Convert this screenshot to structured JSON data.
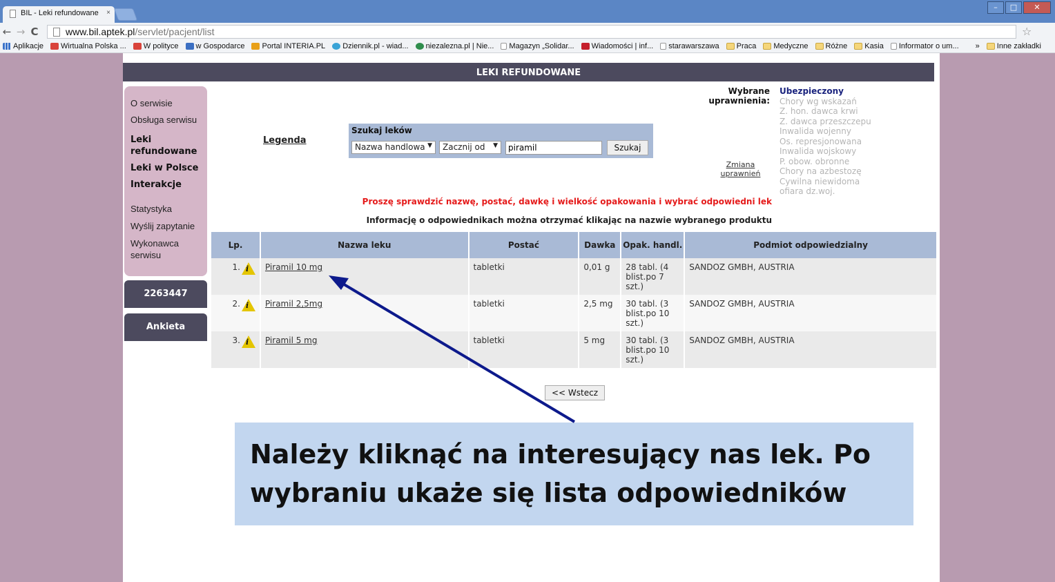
{
  "browser": {
    "tab_title": "BIL - Leki refundowane",
    "tab_close": "×",
    "url_domain": "www.bil.aptek.pl",
    "url_path": "/servlet/pacjent/list",
    "bookmarks": [
      "Aplikacje",
      "Wirtualna Polska ...",
      "W polityce",
      "w Gospodarce",
      "Portal INTERIA.PL",
      "Dziennik.pl - wiad...",
      "niezalezna.pl | Nie...",
      "Magazyn „Solidar...",
      "Wiadomości | inf...",
      "starawarszawa",
      "Praca",
      "Medyczne",
      "Różne",
      "Kasia",
      "Informator o um..."
    ],
    "bookmarks_more": "»",
    "other_bookmarks": "Inne zakładki"
  },
  "header": {
    "title": "LEKI REFUNDOWANE"
  },
  "sidebar": {
    "items": [
      "O serwisie",
      "Obsługa serwisu"
    ],
    "bold_items": [
      "Leki refundowane",
      "Leki w Polsce",
      "Interakcje"
    ],
    "items2": [
      "Statystyka",
      "Wyślij zapytanie",
      "Wykonawca serwisu"
    ],
    "counter": "2263447",
    "survey": "Ankieta"
  },
  "legend_link": "Legenda",
  "search": {
    "title": "Szukaj leków",
    "field_select": "Nazwa handlowa",
    "mode_select": "Zacznij od",
    "query": "piramil",
    "button": "Szukaj"
  },
  "permissions": {
    "label": "Wybrane uprawnienia:",
    "change_link": "Zmiana uprawnień",
    "items": [
      "Ubezpieczony",
      "Chory wg wskazań",
      "Z. hon. dawca krwi",
      "Z. dawca przeszczepu",
      "Inwalida wojenny",
      "Os. represjonowana",
      "Inwalida wojskowy",
      "P. obow. obronne",
      "Chory na azbestozę",
      "Cywilna niewidoma ofiara dz.woj."
    ]
  },
  "messages": {
    "warning": "Proszę sprawdzić nazwę, postać, dawkę i wielkość opakowania i wybrać odpowiedni lek",
    "info": "Informację o odpowiednikach można otrzymać klikając na nazwie wybranego produktu"
  },
  "table": {
    "headers": [
      "Lp.",
      "Nazwa leku",
      "Postać",
      "Dawka",
      "Opak. handl.",
      "Podmiot odpowiedzialny"
    ],
    "rows": [
      {
        "lp": "1.",
        "name": "Piramil 10 mg",
        "form": "tabletki",
        "dose": "0,01 g",
        "pack": "28 tabl. (4 blist.po 7 szt.)",
        "company": "SANDOZ GMBH, AUSTRIA"
      },
      {
        "lp": "2.",
        "name": "Piramil 2,5mg",
        "form": "tabletki",
        "dose": "2,5 mg",
        "pack": "30 tabl. (3 blist.po 10 szt.)",
        "company": "SANDOZ GMBH, AUSTRIA"
      },
      {
        "lp": "3.",
        "name": "Piramil 5 mg",
        "form": "tabletki",
        "dose": "5 mg",
        "pack": "30 tabl. (3 blist.po 10 szt.)",
        "company": "SANDOZ GMBH, AUSTRIA"
      }
    ]
  },
  "back_button": "<< Wstecz",
  "callout": {
    "line1": "Należy kliknąć na interesujący nas lek. Po",
    "line2": "wybraniu ukaże się lista odpowiedników"
  },
  "colors": {
    "header": "#4c4a5e",
    "sidebar": "#d5b6c8",
    "table_header": "#a9bad6",
    "warning": "#e51b1b",
    "callout": "#c2d6ef",
    "arrow": "#0d1a8c"
  }
}
